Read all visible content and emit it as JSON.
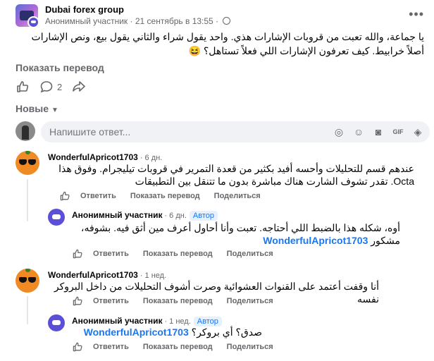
{
  "post": {
    "group_name": "Dubai forex group",
    "author": "Анонимный участник",
    "timestamp": "21 сентябрь в 13:55",
    "separator": "·",
    "text": "يا جماعة، والله تعبت من قروبات الإشارات هذي. واحد يقول شراء والثاني يقول بيع، ونص الإشارات أصلاً خرابيط. كيف تعرفون الإشارات اللي فعلاً تستاهل؟ 😆",
    "translate": "Показать перевод",
    "comment_count": "2"
  },
  "sort": {
    "label": "Новые"
  },
  "composer": {
    "placeholder": "Напишите ответ..."
  },
  "labels": {
    "reply": "Ответить",
    "translate": "Показать перевод",
    "share": "Поделиться",
    "author_badge": "Автор"
  },
  "comments": [
    {
      "name": "WonderfulApricot1703",
      "time": "· 6 дн.",
      "text": "عندهم قسم للتحليلات وأحسه أفيد بكثير من قعدة التمرير في قروبات تيليجرام. وفوق هذا Octa. تقدر تشوف الشارت هناك مباشرة بدون ما تتنقل بين التطبيقات"
    },
    {
      "name": "Анонимный участник",
      "time": "· 6 дн.",
      "mention": "WonderfulApricot1703",
      "text": "أوه، شكله هذا بالضبط اللي أحتاجه. تعبت وأنا أحاول أعرف مين أثق فيه. بشوفه، مشكور"
    },
    {
      "name": "WonderfulApricot1703",
      "time": "· 1 нед.",
      "text": "أنا وقفت أعتمد على القنوات العشوائية وصرت أشوف التحليلات من داخل البروكر نفسه"
    },
    {
      "name": "Анонимный участник",
      "time": "· 1 нед.",
      "mention": "WonderfulApricot1703",
      "text": "صدق؟ أي بروكر؟"
    }
  ]
}
